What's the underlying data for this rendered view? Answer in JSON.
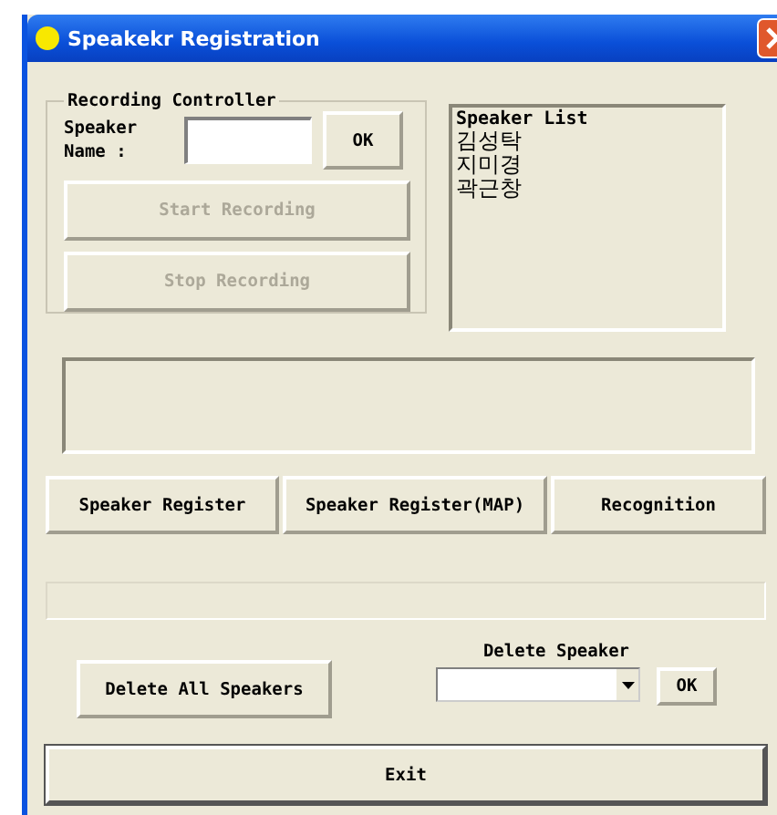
{
  "window": {
    "title": "Speakekr Registration"
  },
  "recording_controller": {
    "title": "Recording Controller",
    "name_label": "Speaker Name :",
    "ok_button": {
      "label": "OK",
      "disabled": false
    },
    "buttons": [
      {
        "label": "Start Recording",
        "disabled": true
      },
      {
        "label": "Stop Recording",
        "disabled": true
      }
    ]
  },
  "speaker_list": {
    "header": "Speaker List",
    "items": [
      "김성탁",
      "지미경",
      "곽근창"
    ]
  },
  "action_buttons": [
    {
      "label": "Speaker Register",
      "disabled": false
    },
    {
      "label": "Speaker Register(MAP)",
      "disabled": false
    },
    {
      "label": "Recognition",
      "disabled": false
    }
  ],
  "progress": {
    "level": 0
  },
  "delete_all_button": {
    "label": "Delete All Speakers",
    "disabled": false
  },
  "delete_speaker": {
    "label": "Delete Speaker",
    "ok_button": {
      "label": "OK",
      "disabled": false
    }
  },
  "exit_button": {
    "label": "Exit",
    "disabled": false
  }
}
